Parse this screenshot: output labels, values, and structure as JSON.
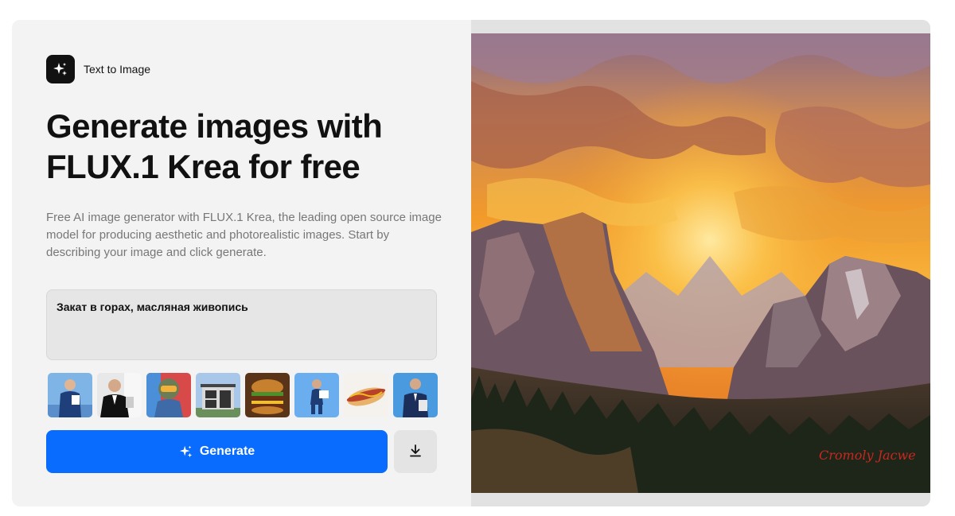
{
  "badge": {
    "label": "Text to Image",
    "icon": "sparkle-icon"
  },
  "hero": {
    "title": "Generate images with FLUX.1 Krea for free",
    "description": "Free AI image generator with FLUX.1 Krea, the leading open source image model for producing aesthetic and photorealistic images. Start by describing your image and click generate."
  },
  "prompt": {
    "value": "Закат в горах, масляная живопись"
  },
  "examples": [
    {
      "name": "businessman-blue"
    },
    {
      "name": "man-tuxedo"
    },
    {
      "name": "pilot-helmet"
    },
    {
      "name": "modern-house"
    },
    {
      "name": "burger"
    },
    {
      "name": "delivery-man"
    },
    {
      "name": "hotdog"
    },
    {
      "name": "man-suit-tablet"
    }
  ],
  "actions": {
    "generate_label": "Generate",
    "generate_icon": "sparkle-icon",
    "download_icon": "download-icon"
  },
  "preview": {
    "signature": "Cromoly Jacwe"
  },
  "colors": {
    "accent": "#0a6cff",
    "card": "#f3f3f3"
  }
}
